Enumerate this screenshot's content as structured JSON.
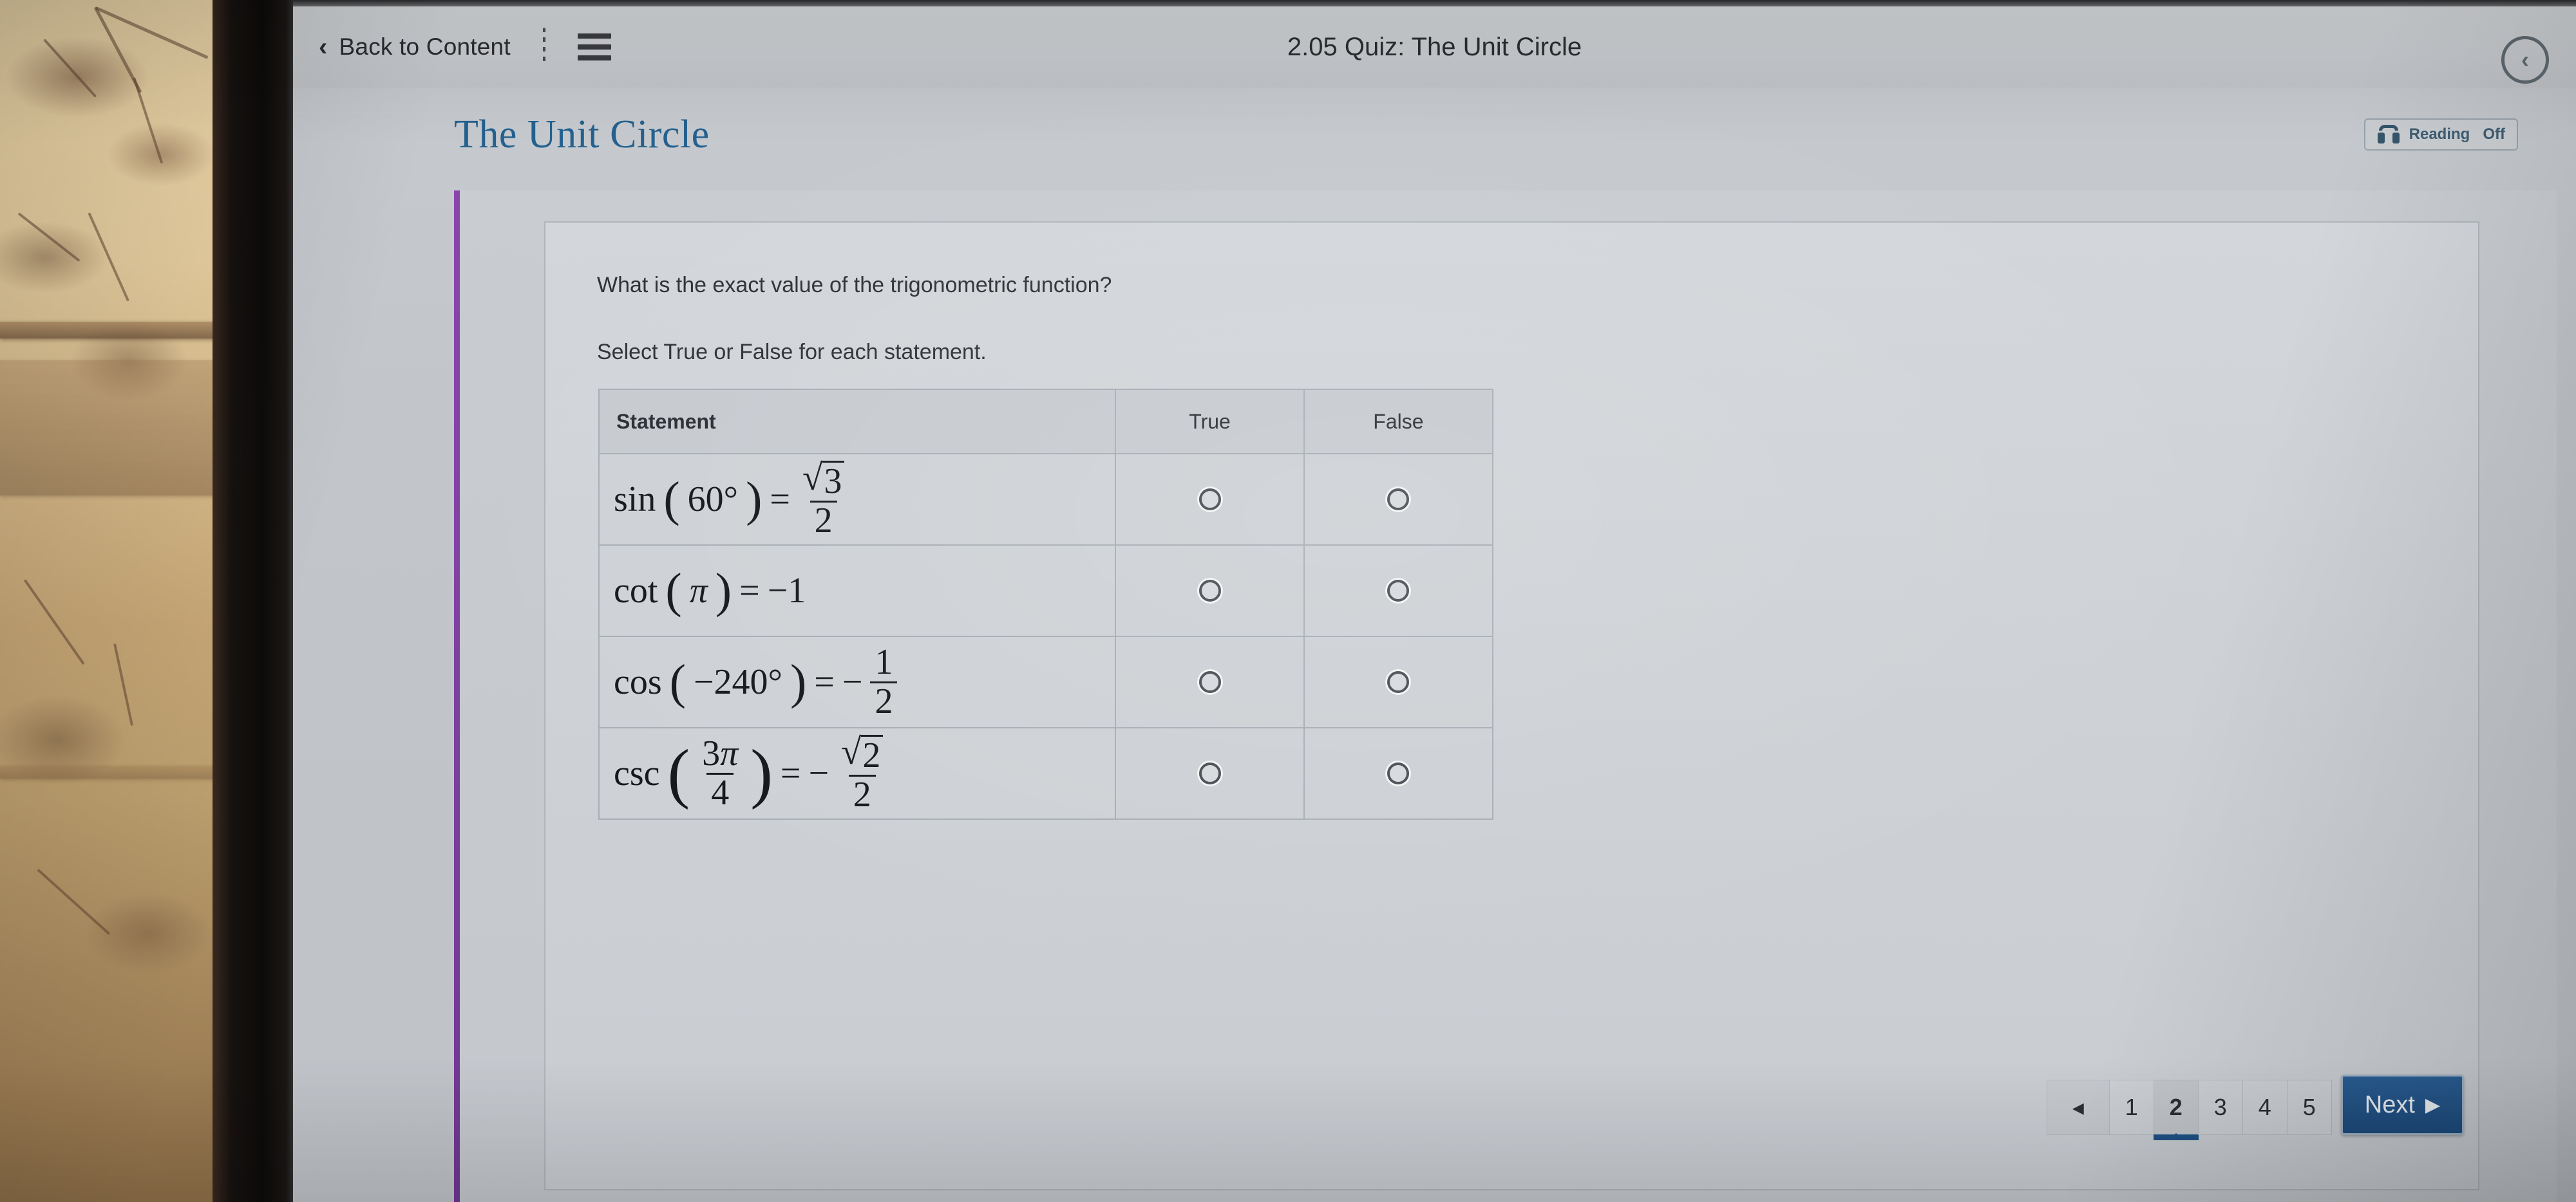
{
  "topbar": {
    "back_label": "Back to Content",
    "back_chevron": "‹",
    "menu_icon": "hamburger-icon",
    "title": "2.05 Quiz: The Unit Circle",
    "collapse_icon": "‹"
  },
  "page": {
    "heading": "The Unit Circle",
    "reading": {
      "icon": "headphones-icon",
      "label": "Reading",
      "state": "Off"
    }
  },
  "question": {
    "prompt": "What is the exact value of the trigonometric function?",
    "instruction": "Select True or False for each statement.",
    "table": {
      "headers": [
        "Statement",
        "True",
        "False"
      ],
      "rows": [
        {
          "statement_text": "sin (60°) = √3/2",
          "func": "sin",
          "arg": "60°",
          "rhs_type": "fraction-sqrt",
          "numerator": "3",
          "denominator": "2",
          "negative": false,
          "true_selected": false,
          "false_selected": false
        },
        {
          "statement_text": "cot (π) = −1",
          "func": "cot",
          "arg": "π",
          "rhs_type": "integer",
          "value": "1",
          "negative": true,
          "true_selected": false,
          "false_selected": false
        },
        {
          "statement_text": "cos (−240°) = −1/2",
          "func": "cos",
          "arg": "−240°",
          "rhs_type": "fraction",
          "numerator": "1",
          "denominator": "2",
          "negative": true,
          "true_selected": false,
          "false_selected": false
        },
        {
          "statement_text": "csc (3π/4) = −√2/2",
          "func": "csc",
          "arg_type": "fraction",
          "arg_num": "3π",
          "arg_den": "4",
          "rhs_type": "fraction-sqrt",
          "numerator": "2",
          "denominator": "2",
          "negative": true,
          "true_selected": false,
          "false_selected": false
        }
      ]
    }
  },
  "pagination": {
    "prev_icon": "◂",
    "pages": [
      "1",
      "2",
      "3",
      "4",
      "5"
    ],
    "active_page": "2",
    "next_label": "Next",
    "next_icon": "▶"
  },
  "colors": {
    "heading_blue": "#24618f",
    "accent_purple": "#7b3f9e",
    "next_button_blue": "#1f5186",
    "active_underline": "#1f5186"
  }
}
